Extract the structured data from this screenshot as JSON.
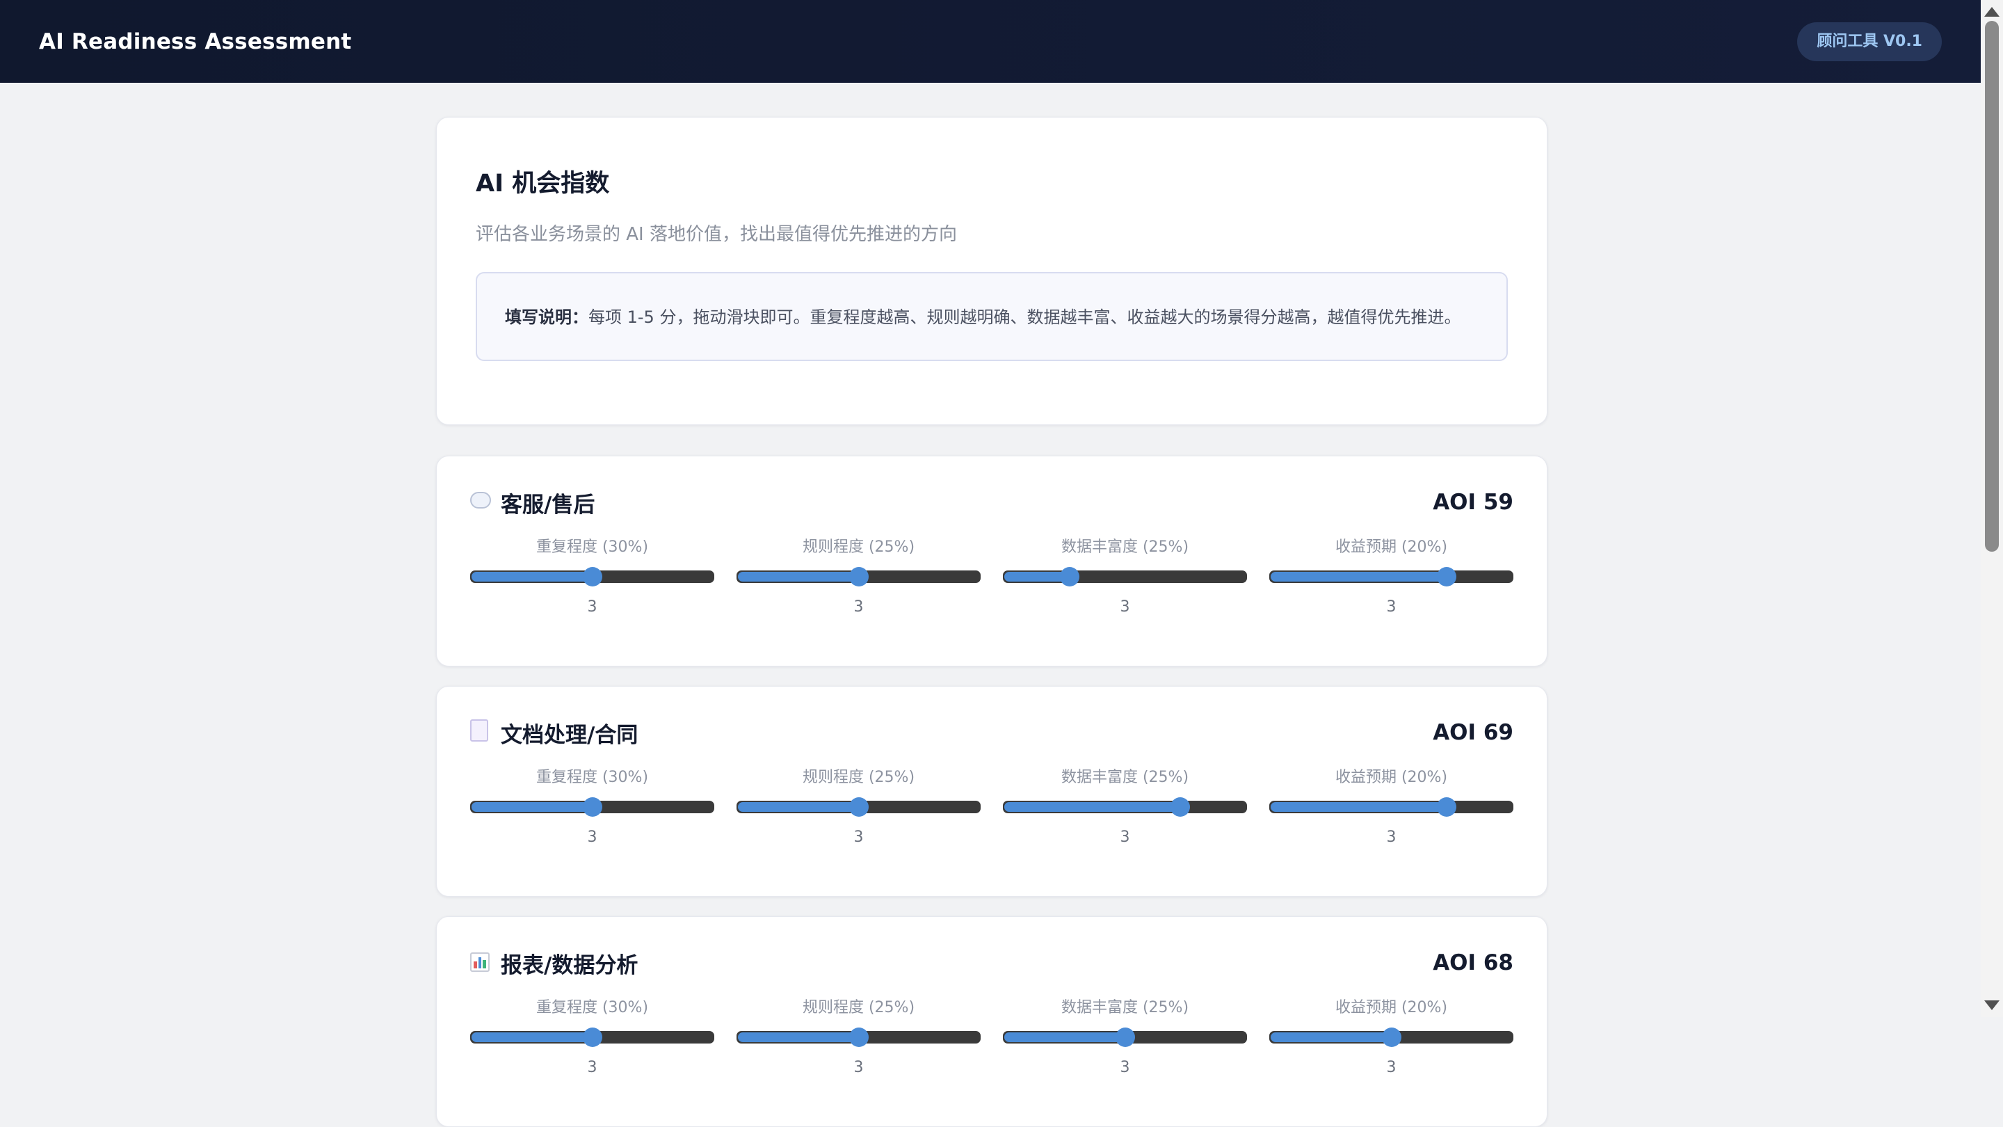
{
  "header": {
    "app_title": "AI Readiness Assessment",
    "version_badge": "顾问工具 V0.1"
  },
  "intro": {
    "title": "AI 机会指数",
    "subtitle": "评估各业务场景的 AI 落地价值，找出最值得优先推进的方向",
    "instructions_label": "填写说明：",
    "instructions_text": "每项 1-5 分，拖动滑块即可。重复程度越高、规则越明确、数据越丰富、收益越大的场景得分越高，越值得优先推进。"
  },
  "colors": {
    "accent": "#4a8bd6",
    "track": "#3a3a3a",
    "topbar": "#10182e",
    "badge_bg": "#26365a",
    "badge_text": "#9ec7f2"
  },
  "scenes": [
    {
      "icon": "speech-bubble-icon",
      "name": "客服/售后",
      "aoi": "AOI 59",
      "sliders": [
        {
          "label": "重复程度 (30%)",
          "value": "3",
          "level": 0.5
        },
        {
          "label": "规则程度 (25%)",
          "value": "3",
          "level": 0.5
        },
        {
          "label": "数据丰富度 (25%)",
          "value": "3",
          "level": 0.27
        },
        {
          "label": "收益预期 (20%)",
          "value": "3",
          "level": 0.73
        }
      ]
    },
    {
      "icon": "document-icon",
      "name": "文档处理/合同",
      "aoi": "AOI 69",
      "sliders": [
        {
          "label": "重复程度 (30%)",
          "value": "3",
          "level": 0.5
        },
        {
          "label": "规则程度 (25%)",
          "value": "3",
          "level": 0.5
        },
        {
          "label": "数据丰富度 (25%)",
          "value": "3",
          "level": 0.73
        },
        {
          "label": "收益预期 (20%)",
          "value": "3",
          "level": 0.73
        }
      ]
    },
    {
      "icon": "bar-chart-icon",
      "name": "报表/数据分析",
      "aoi": "AOI 68",
      "sliders": [
        {
          "label": "重复程度 (30%)",
          "value": "3",
          "level": 0.5
        },
        {
          "label": "规则程度 (25%)",
          "value": "3",
          "level": 0.5
        },
        {
          "label": "数据丰富度 (25%)",
          "value": "3",
          "level": 0.5
        },
        {
          "label": "收益预期 (20%)",
          "value": "3",
          "level": 0.5
        }
      ]
    }
  ]
}
